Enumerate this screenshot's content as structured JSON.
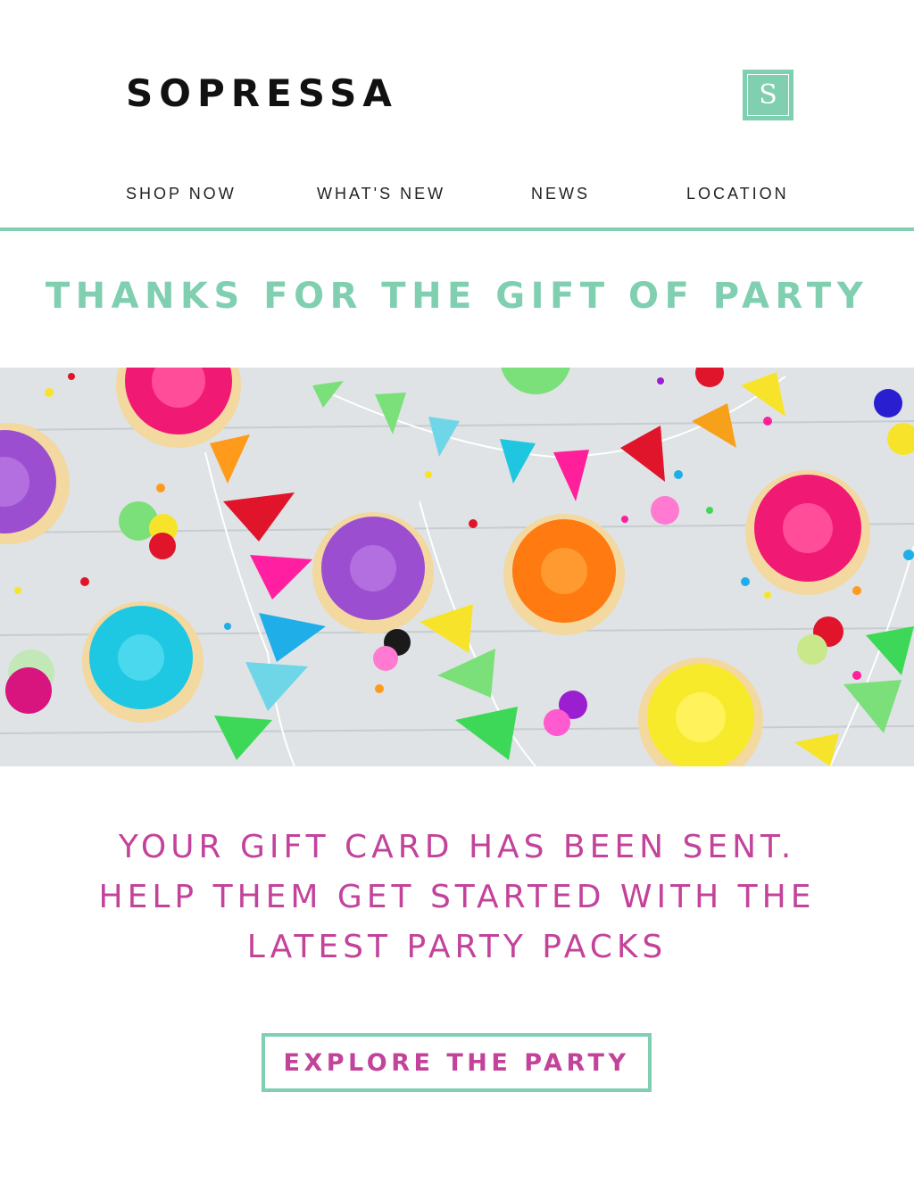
{
  "brand": {
    "name": "SOPRESSA",
    "logo_letter": "S"
  },
  "nav": {
    "items": [
      {
        "label": "SHOP NOW"
      },
      {
        "label": "WHAT'S NEW"
      },
      {
        "label": "NEWS"
      },
      {
        "label": "LOCATION"
      }
    ]
  },
  "headline": "THANKS FOR THE GIFT OF PARTY",
  "hero": {
    "image": "cupcakes-and-bunting-party-photo"
  },
  "message": {
    "lines": [
      "YOUR GIFT CARD HAS BEEN SENT.",
      "HELP THEM GET STARTED WITH THE",
      "LATEST PARTY PACKS"
    ]
  },
  "cta": {
    "label": "EXPLORE THE PARTY"
  },
  "colors": {
    "accent": "#7fcfb0",
    "message": "#c3439b",
    "text": "#111111"
  }
}
